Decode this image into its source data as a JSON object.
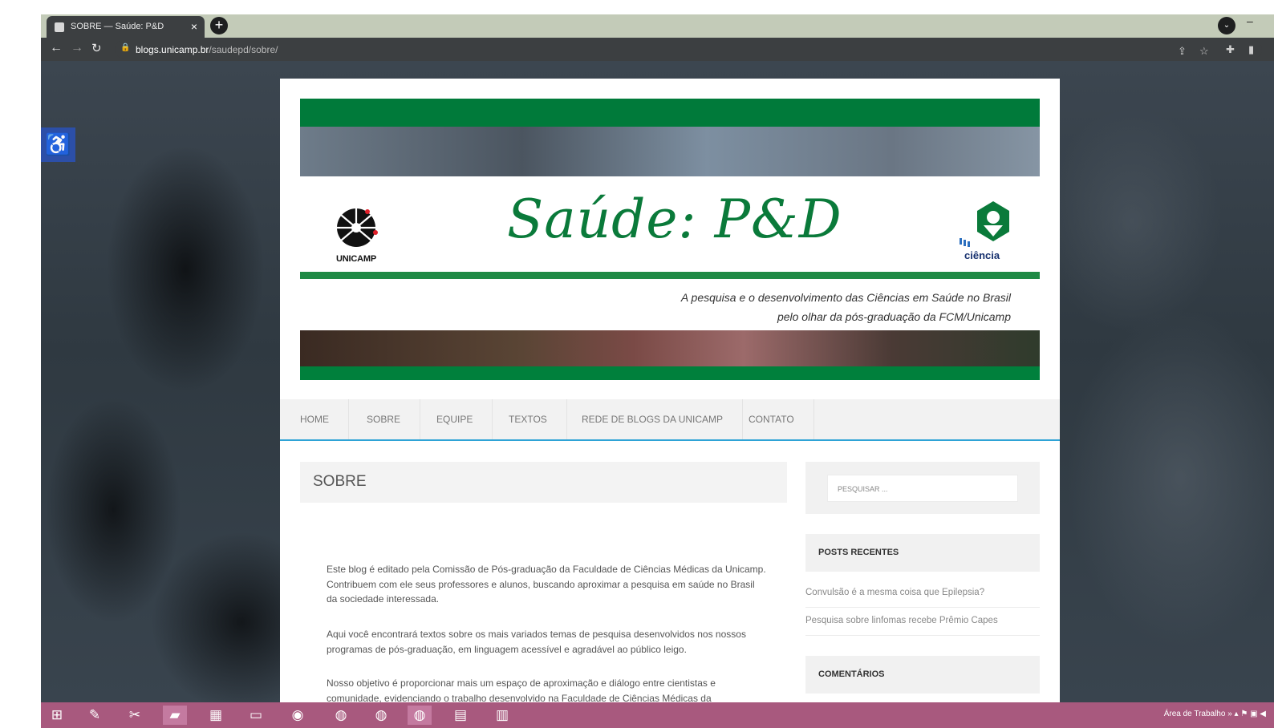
{
  "browser": {
    "tab_title": "SOBRE — Saúde: P&D",
    "tab_close": "×",
    "new_tab": "+",
    "url_host": "blogs.unicamp.br",
    "url_path": "/saudepd/sobre/"
  },
  "banner": {
    "logo_left": "UNICAMP",
    "title": "Saúde: P&D",
    "subtitle_line1": "A pesquisa e o desenvolvimento das Ciências em Saúde no Brasil",
    "subtitle_line2": "pelo olhar da pós-graduação da FCM/Unicamp",
    "logo_right": "ciência"
  },
  "menu": {
    "items": [
      "HOME",
      "SOBRE",
      "EQUIPE",
      "TEXTOS",
      "REDE DE BLOGS DA UNICAMP",
      "CONTATO"
    ]
  },
  "page": {
    "title": "SOBRE",
    "paragraphs": [
      "Este blog é editado pela Comissão de Pós-graduação da Faculdade de Ciências Médicas da Unicamp. Contribuem com ele seus professores e alunos, buscando aproximar a pesquisa em saúde no Brasil da sociedade interessada.",
      "Aqui você encontrará textos sobre os mais variados temas de pesquisa desenvolvidos nos nossos programas de pós-graduação, em linguagem acessível e agradável ao público leigo.",
      "Nosso objetivo é proporcionar mais um espaço de aproximação e diálogo entre cientistas e comunidade, evidenciando o trabalho desenvolvido na Faculdade de Ciências Médicas da"
    ]
  },
  "sidebar": {
    "search_placeholder": "PESQUISAR ...",
    "recent_title": "POSTS RECENTES",
    "recent_posts": [
      "Convulsão é a mesma coisa que Epilepsia?",
      "Pesquisa sobre linfomas recebe Prêmio Capes"
    ],
    "comments_title": "COMENTÁRIOS"
  },
  "taskbar": {
    "tray_label": "Área de Trabalho"
  },
  "colors": {
    "brand_green": "#007a3a",
    "menu_accent": "#2ea3d6",
    "taskbar": "#a8597e"
  }
}
